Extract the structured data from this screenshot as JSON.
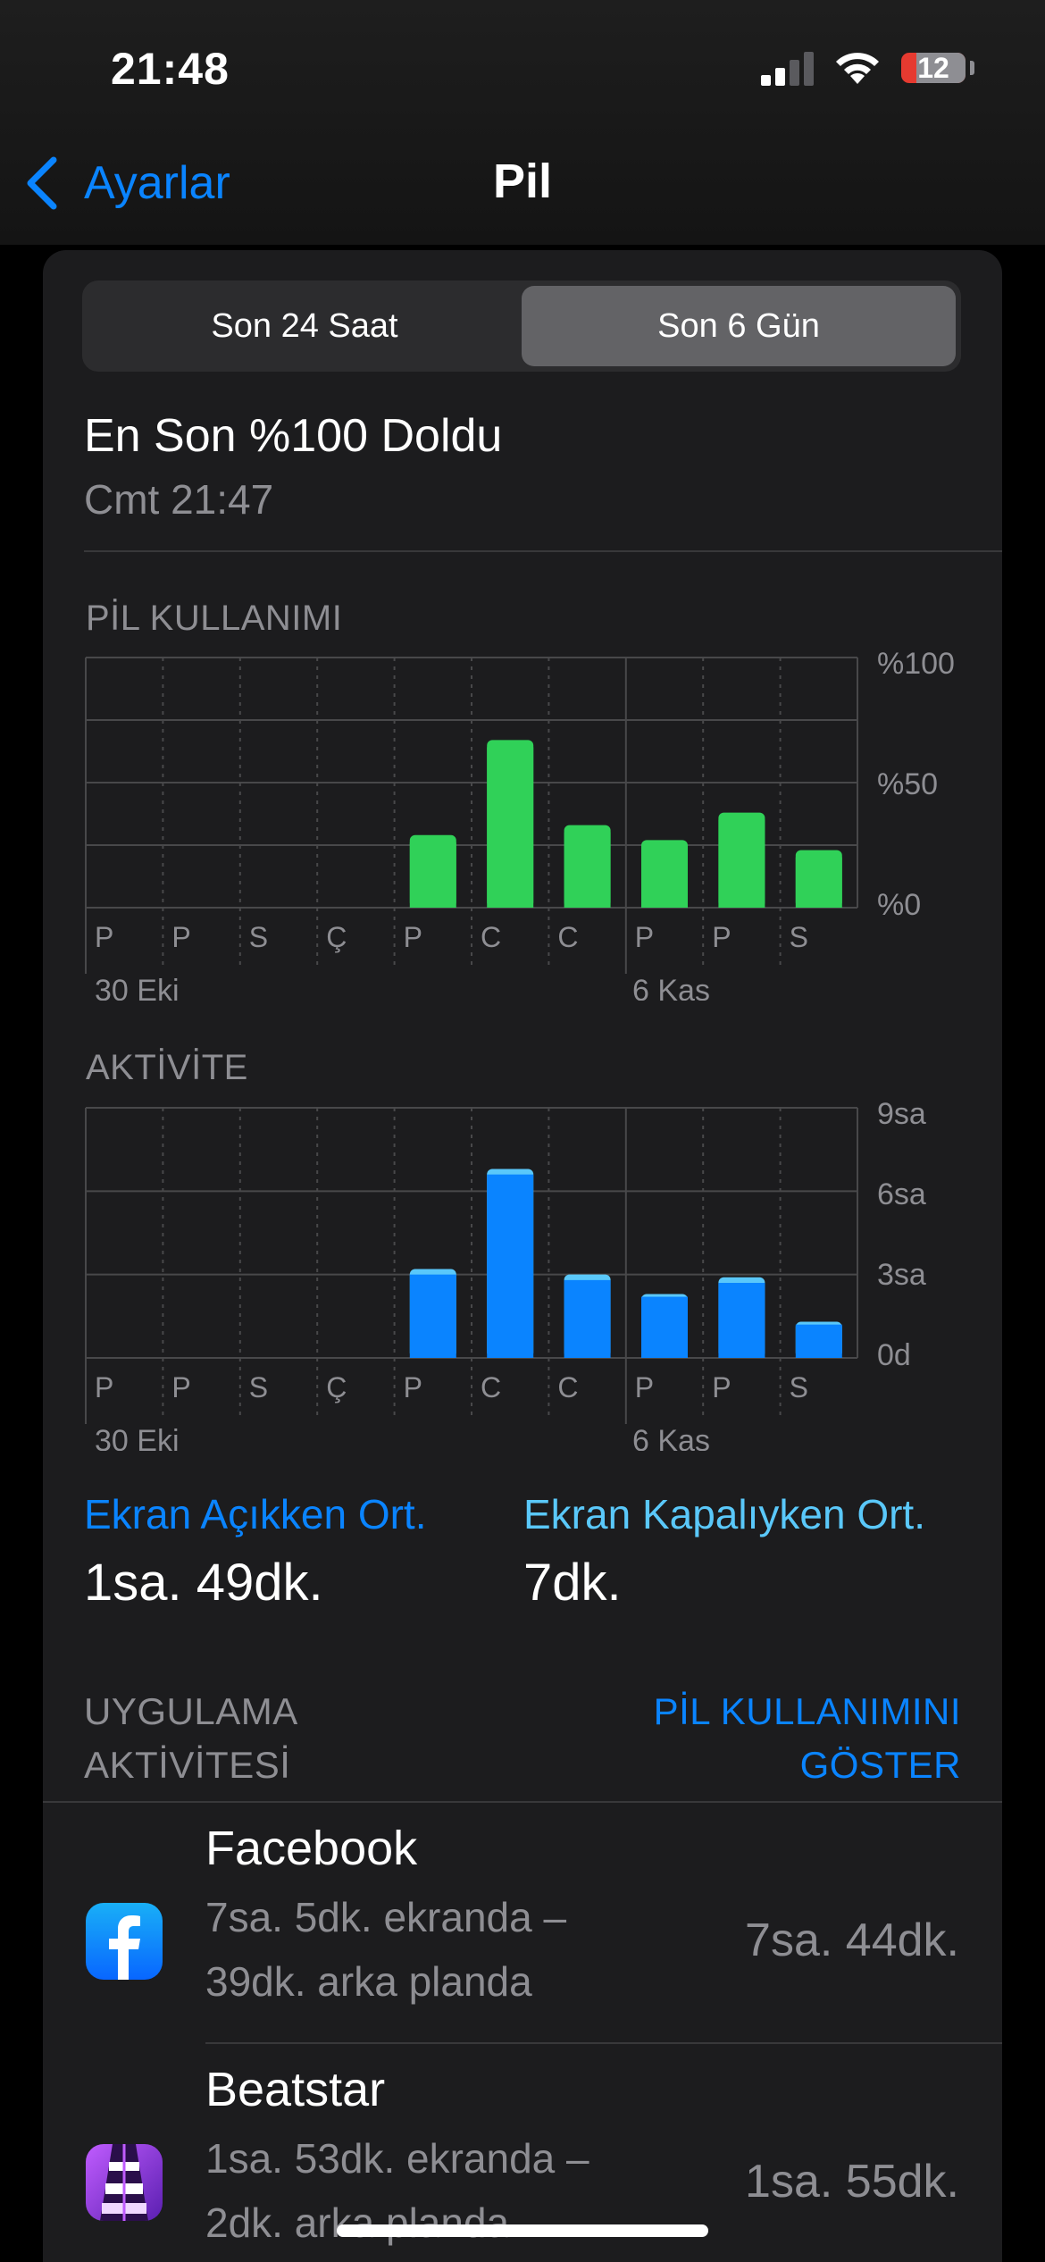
{
  "status_bar": {
    "time": "21:48",
    "battery_level": "12"
  },
  "nav": {
    "back_label": "Ayarlar",
    "title": "Pil"
  },
  "segmented": {
    "options": [
      "Son 24 Saat",
      "Son 6 Gün"
    ],
    "selected": "Son 6 Gün"
  },
  "last_charge": {
    "title": "En Son %100 Doldu",
    "subtitle": "Cmt 21:47"
  },
  "battery_usage": {
    "label": "PİL KULLANIMI",
    "ticks": [
      "%100",
      "%50",
      "%0"
    ],
    "days": [
      "P",
      "P",
      "S",
      "Ç",
      "P",
      "C",
      "C",
      "P",
      "P",
      "S"
    ],
    "dates": [
      "30 Eki",
      "6 Kas"
    ]
  },
  "activity": {
    "label": "AKTİVİTE",
    "ticks": [
      "9sa",
      "6sa",
      "3sa",
      "0d"
    ],
    "days": [
      "P",
      "P",
      "S",
      "Ç",
      "P",
      "C",
      "C",
      "P",
      "P",
      "S"
    ],
    "dates": [
      "30 Eki",
      "6 Kas"
    ]
  },
  "chart_data": [
    {
      "type": "bar",
      "title": "PİL KULLANIMI",
      "categories": [
        "P",
        "P",
        "S",
        "Ç",
        "P",
        "C",
        "C",
        "P",
        "P",
        "S"
      ],
      "series": [
        {
          "values": [
            0,
            0,
            0,
            0,
            29,
            67,
            33,
            27,
            38,
            23
          ]
        }
      ],
      "ylim": [
        0,
        100
      ],
      "yticks": [
        "%0",
        "%50",
        "%100"
      ],
      "x_date_labels": [
        "30 Eki",
        "6 Kas"
      ],
      "color": "#30d158"
    },
    {
      "type": "bar",
      "title": "AKTİVİTE",
      "categories": [
        "P",
        "P",
        "S",
        "Ç",
        "P",
        "C",
        "C",
        "P",
        "P",
        "S"
      ],
      "series": [
        {
          "values": [
            0,
            0,
            0,
            0,
            3.0,
            6.6,
            2.8,
            2.2,
            2.7,
            1.2
          ]
        },
        {
          "values": [
            0,
            0,
            0,
            0,
            0.2,
            0.2,
            0.2,
            0.1,
            0.2,
            0.1
          ]
        }
      ],
      "stacked": true,
      "ylim": [
        0,
        9
      ],
      "yticks": [
        "0d",
        "3sa",
        "6sa",
        "9sa"
      ],
      "x_date_labels": [
        "30 Eki",
        "6 Kas"
      ],
      "colors": [
        "#0a84ff",
        "#5ac8fa"
      ]
    }
  ],
  "averages": {
    "screen_on_label": "Ekran Açıkken Ort.",
    "screen_on_value": "1sa. 49dk.",
    "screen_off_label": "Ekran Kapalıyken Ort.",
    "screen_off_value": "7dk."
  },
  "app_activity": {
    "label_line1": "UYGULAMA",
    "label_line2": "AKTİVİTESİ",
    "toggle_line1": "PİL KULLANIMINI",
    "toggle_line2": "GÖSTER"
  },
  "apps": [
    {
      "name": "Facebook",
      "detail_line1": "7sa. 5dk. ekranda –",
      "detail_line2": "39dk. arka planda",
      "total": "7sa. 44dk."
    },
    {
      "name": "Beatstar",
      "detail_line1": "1sa. 53dk. ekranda –",
      "detail_line2": "2dk. arka planda",
      "total": "1sa. 55dk."
    }
  ],
  "colors": {
    "accent": "#0a84ff",
    "green": "#30d158",
    "background": "#000000",
    "card": "#1c1c1e"
  }
}
